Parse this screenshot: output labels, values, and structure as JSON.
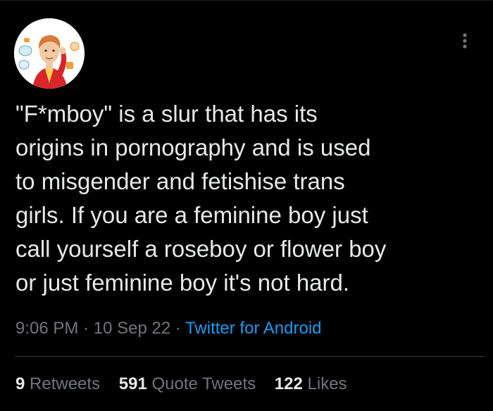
{
  "tweet": {
    "text": "\"F*mboy\" is a slur that has its\norigins in pornography and is used\nto misgender and fetishise trans\ngirls. If you are a feminine boy just\ncall yourself a roseboy or flower boy\nor just feminine boy it's not hard.",
    "time": "9:06 PM",
    "date": "10 Sep 22",
    "separator": "·",
    "source": "Twitter for Android"
  },
  "stats": [
    {
      "count": "9",
      "label": "Retweets"
    },
    {
      "count": "591",
      "label": "Quote Tweets"
    },
    {
      "count": "122",
      "label": "Likes"
    }
  ],
  "icons": {
    "avatar": "avatar-illustration",
    "more": "more-vertical-icon"
  },
  "colors": {
    "background": "#000000",
    "text": "#e7e9ea",
    "muted": "#71767b",
    "link": "#1d9bf0",
    "divider": "#2f3336"
  }
}
